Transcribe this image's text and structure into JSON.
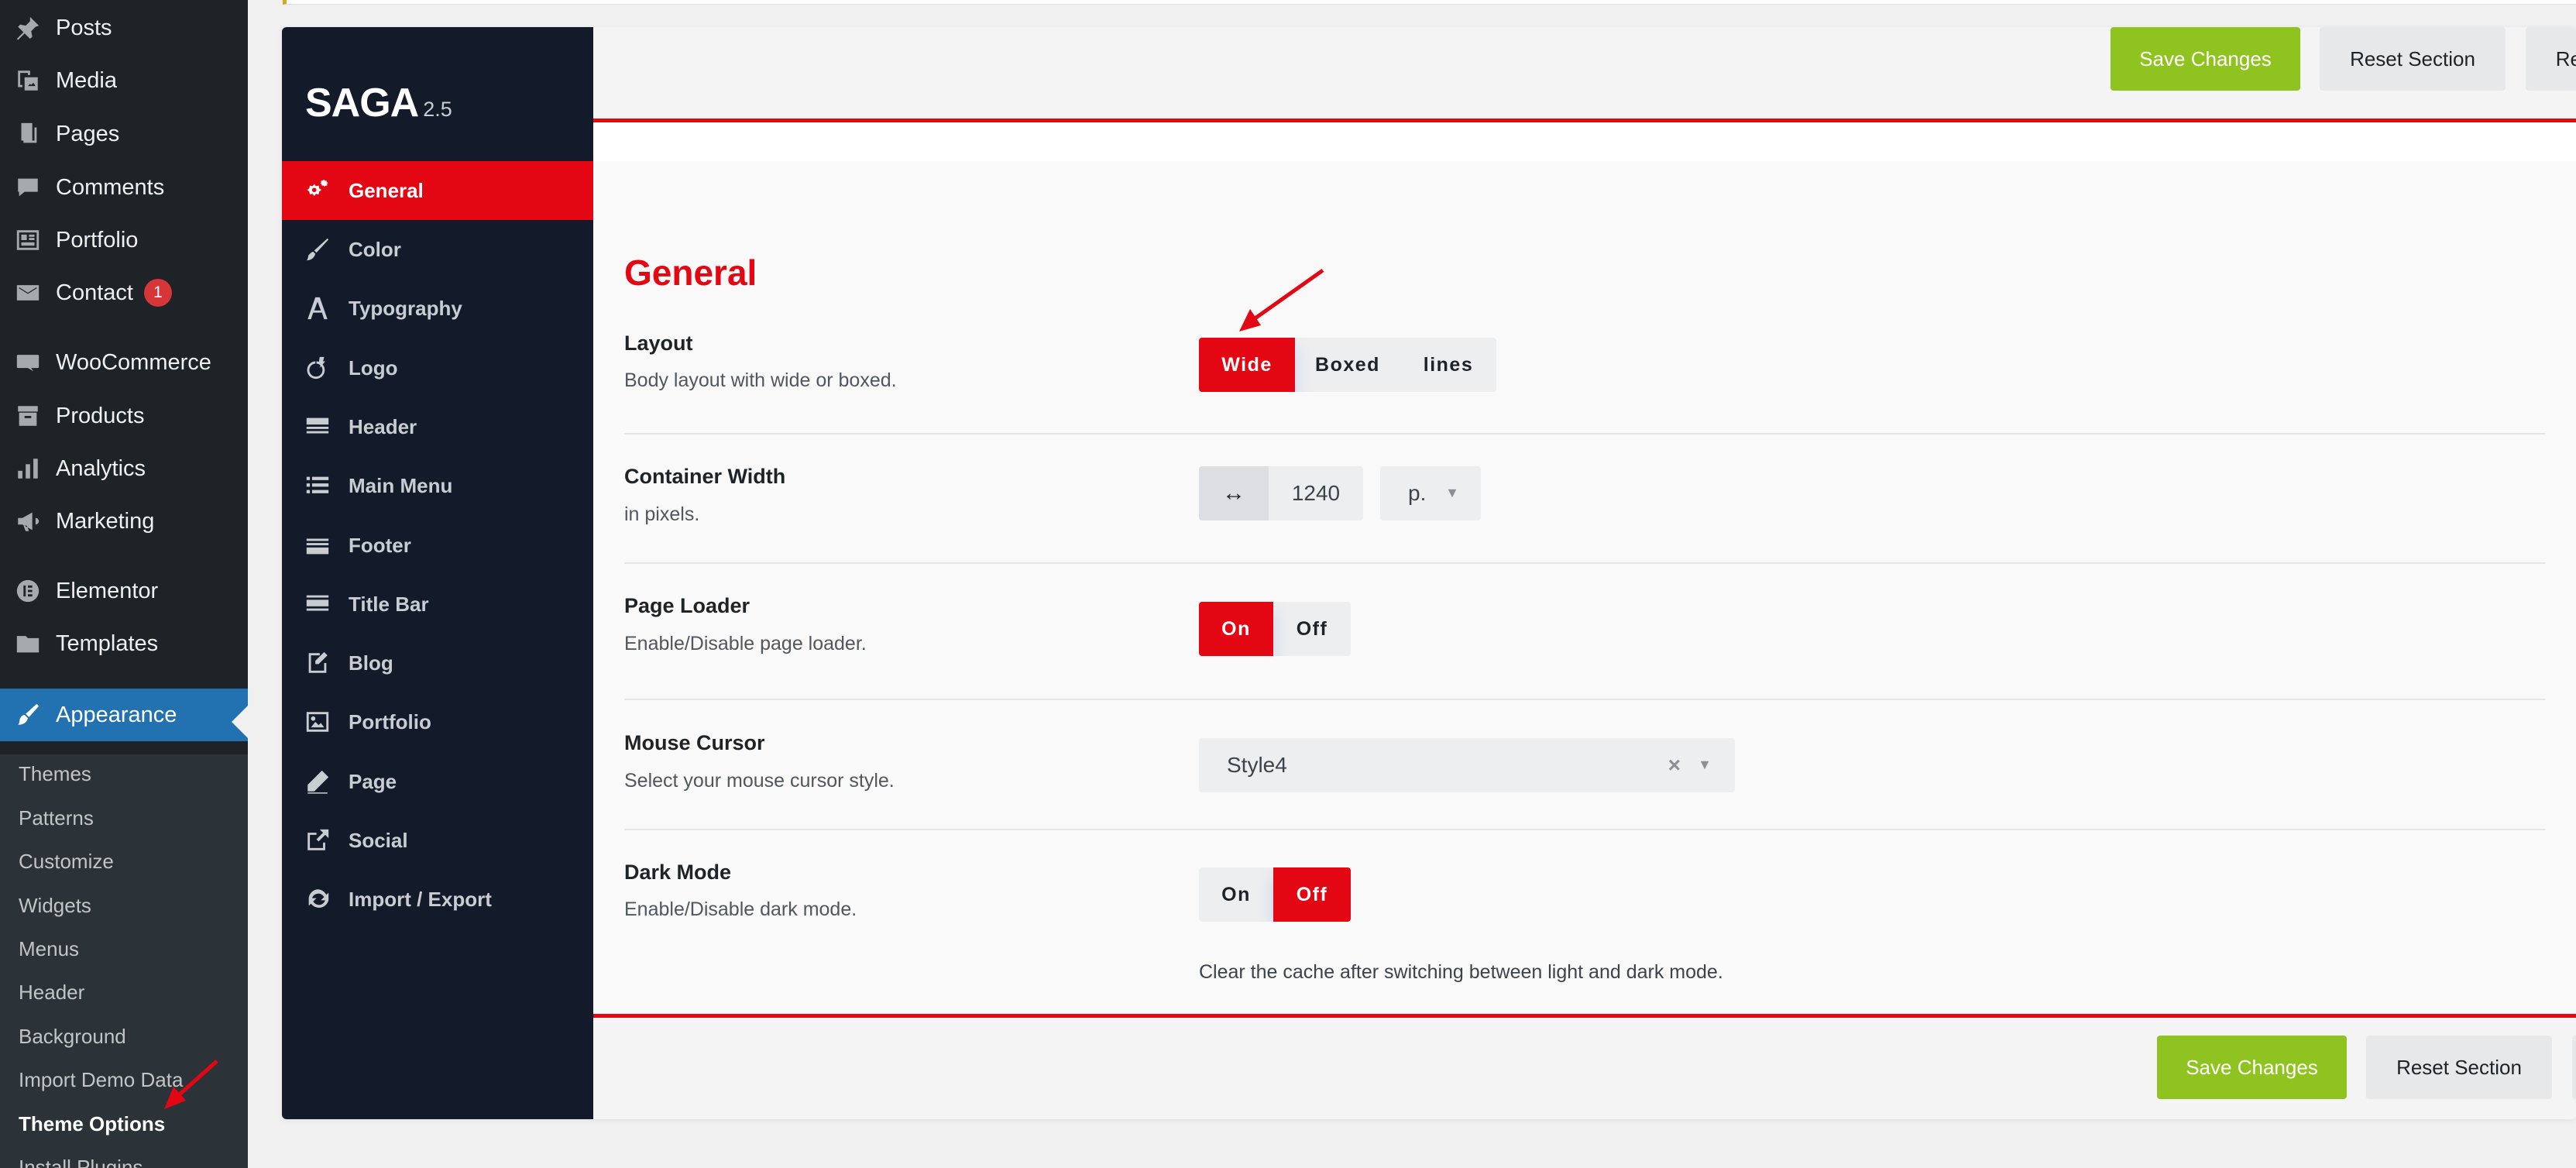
{
  "wp_menu": {
    "items": [
      {
        "label": "Posts",
        "icon": "pin-icon"
      },
      {
        "label": "Media",
        "icon": "media-icon"
      },
      {
        "label": "Pages",
        "icon": "pages-icon"
      },
      {
        "label": "Comments",
        "icon": "comment-icon"
      },
      {
        "label": "Portfolio",
        "icon": "portfolio-icon"
      },
      {
        "label": "Contact",
        "icon": "mail-icon",
        "badge": "1"
      },
      {
        "label": "WooCommerce",
        "icon": "woo-icon"
      },
      {
        "label": "Products",
        "icon": "archive-icon"
      },
      {
        "label": "Analytics",
        "icon": "bar-chart-icon"
      },
      {
        "label": "Marketing",
        "icon": "megaphone-icon"
      },
      {
        "label": "Elementor",
        "icon": "elementor-icon"
      },
      {
        "label": "Templates",
        "icon": "folder-icon"
      },
      {
        "label": "Appearance",
        "icon": "brush-icon"
      }
    ],
    "submenu": [
      "Themes",
      "Patterns",
      "Customize",
      "Widgets",
      "Menus",
      "Header",
      "Background",
      "Import Demo Data",
      "Theme Options",
      "Install Plugins"
    ]
  },
  "brand": {
    "name": "SAGA",
    "version": "2.5"
  },
  "panel_nav": [
    {
      "label": "General",
      "icon": "cogs-icon"
    },
    {
      "label": "Color",
      "icon": "brush-icon"
    },
    {
      "label": "Typography",
      "icon": "font-icon"
    },
    {
      "label": "Logo",
      "icon": "logo-icon"
    },
    {
      "label": "Header",
      "icon": "header-icon"
    },
    {
      "label": "Main Menu",
      "icon": "list-icon"
    },
    {
      "label": "Footer",
      "icon": "footer-icon"
    },
    {
      "label": "Title Bar",
      "icon": "title-bar-icon"
    },
    {
      "label": "Blog",
      "icon": "edit-icon"
    },
    {
      "label": "Portfolio",
      "icon": "image-icon"
    },
    {
      "label": "Page",
      "icon": "pencil-icon"
    },
    {
      "label": "Social",
      "icon": "share-icon"
    },
    {
      "label": "Import / Export",
      "icon": "refresh-icon"
    }
  ],
  "actions": {
    "save": "Save Changes",
    "reset_section": "Reset Section",
    "reset_all": "Reset All"
  },
  "section": {
    "title": "General"
  },
  "options": {
    "layout": {
      "label": "Layout",
      "desc": "Body layout with wide or boxed.",
      "choices": [
        "Wide",
        "Boxed",
        "lines"
      ],
      "selected": "Wide"
    },
    "container_width": {
      "label": "Container Width",
      "desc": "in pixels.",
      "addon": "↔",
      "value": "1240",
      "unit": "p."
    },
    "page_loader": {
      "label": "Page Loader",
      "desc": "Enable/Disable page loader.",
      "on": "On",
      "off": "Off",
      "selected": "On"
    },
    "mouse_cursor": {
      "label": "Mouse Cursor",
      "desc": "Select your mouse cursor style.",
      "value": "Style4",
      "clear": "×"
    },
    "dark_mode": {
      "label": "Dark Mode",
      "desc": "Enable/Disable dark mode.",
      "on": "On",
      "off": "Off",
      "selected": "Off",
      "note": "Clear the cache after switching between light and dark mode."
    }
  },
  "colors": {
    "accent": "#e30613",
    "save": "#8fc31f",
    "wp_active": "#2271b1",
    "wp_sidebar": "#1d2327",
    "panel_sidebar": "#131b2b"
  }
}
